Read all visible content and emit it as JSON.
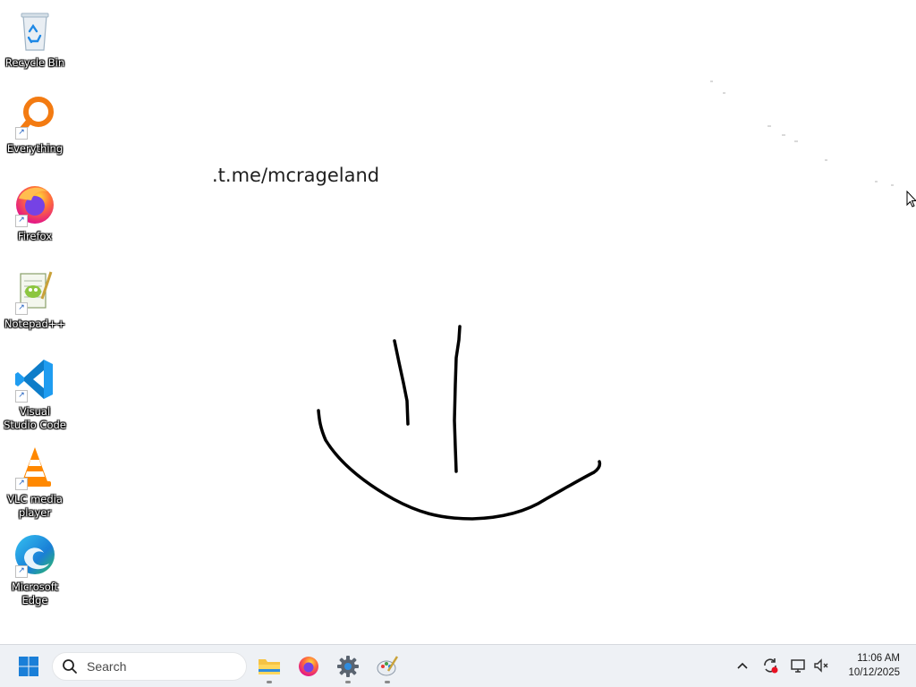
{
  "desktop": {
    "icons": [
      {
        "label": "Recycle Bin",
        "icon": "recycle-bin-icon"
      },
      {
        "label": "Everything",
        "icon": "everything-search-icon"
      },
      {
        "label": "Firefox",
        "icon": "firefox-icon"
      },
      {
        "label": "Notepad++",
        "icon": "notepad-plus-plus-icon"
      },
      {
        "label": "Visual Studio Code",
        "icon": "vscode-icon"
      },
      {
        "label": "VLC media player",
        "icon": "vlc-icon"
      },
      {
        "label": "Microsoft Edge",
        "icon": "edge-icon"
      }
    ],
    "wallpaper_text": ".t.me/mcrageland"
  },
  "taskbar": {
    "search_placeholder": "Search",
    "pinned": [
      {
        "name": "File Explorer",
        "icon": "file-explorer-icon"
      },
      {
        "name": "Firefox",
        "icon": "firefox-icon"
      },
      {
        "name": "Settings",
        "icon": "settings-gear-icon"
      },
      {
        "name": "Paint",
        "icon": "paint-icon"
      }
    ],
    "clock": {
      "time": "11:06 AM",
      "date": "10/12/2025"
    }
  },
  "colors": {
    "taskbar_bg": "#eef1f5",
    "accent": "#0078d4",
    "desktop_bg": "#ffffff"
  }
}
